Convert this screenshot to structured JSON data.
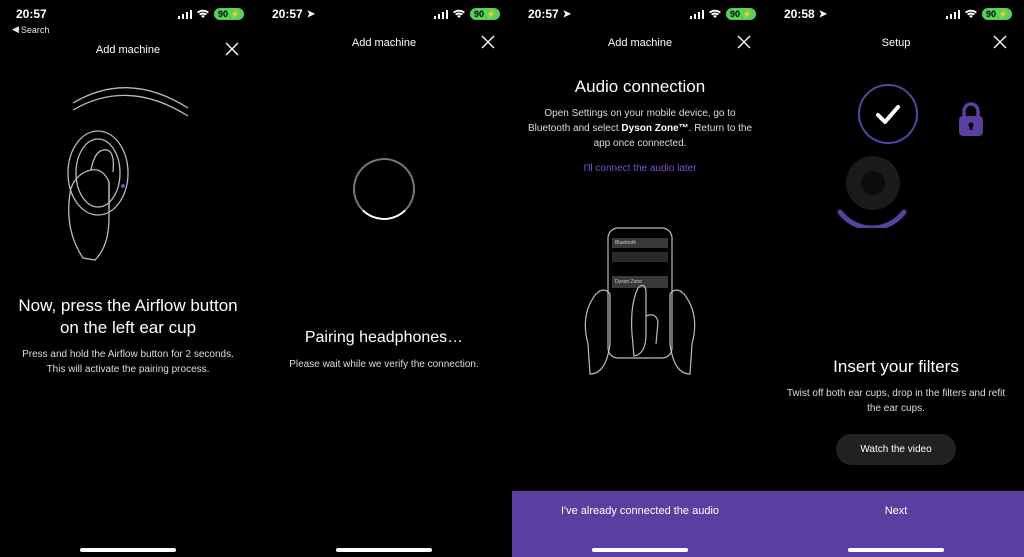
{
  "colors": {
    "accent": "#5b3fa0",
    "battery": "#55d25a"
  },
  "screens": [
    {
      "statusbar": {
        "time": "20:57",
        "back_label": "Search",
        "battery": "90",
        "show_location": false,
        "show_back": true
      },
      "header": {
        "title": "Add machine"
      },
      "heading": "Now, press the Airflow button on the left ear cup",
      "subtext": "Press and hold the Airflow button for 2 seconds. This will activate the pairing process."
    },
    {
      "statusbar": {
        "time": "20:57",
        "back_label": "",
        "battery": "90",
        "show_location": true,
        "show_back": false
      },
      "header": {
        "title": "Add machine"
      },
      "heading": "Pairing headphones…",
      "subtext": "Please wait while we verify the connection."
    },
    {
      "statusbar": {
        "time": "20:57",
        "back_label": "",
        "battery": "90",
        "show_location": true,
        "show_back": false
      },
      "header": {
        "title": "Add machine"
      },
      "heading": "Audio connection",
      "sub_pre": "Open Settings on your mobile device, go to Bluetooth and select ",
      "sub_bold": "Dyson Zone™",
      "sub_post": ". Return to the app once connected.",
      "link": "I'll connect the audio later",
      "phone_header": "Bluetooth",
      "phone_item": "Dyson Zone",
      "bottom_button": "I've already connected the audio"
    },
    {
      "statusbar": {
        "time": "20:58",
        "back_label": "",
        "battery": "90",
        "show_location": true,
        "show_back": false
      },
      "header": {
        "title": "Setup"
      },
      "heading": "Insert your filters",
      "subtext": "Twist off both ear cups, drop in the filters and refit the ear cups.",
      "pill_button": "Watch the video",
      "bottom_button": "Next"
    }
  ]
}
